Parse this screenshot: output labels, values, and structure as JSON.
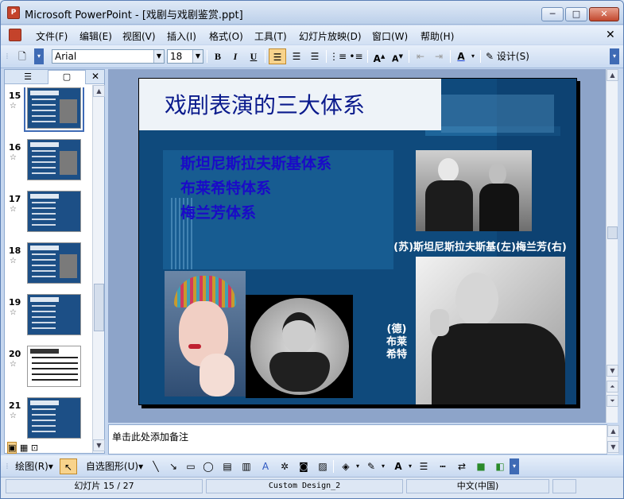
{
  "window": {
    "title": "Microsoft PowerPoint - [戏剧与戏剧鉴赏.ppt]",
    "app_icon": "P"
  },
  "menu": [
    "文件(F)",
    "编辑(E)",
    "视图(V)",
    "插入(I)",
    "格式(O)",
    "工具(T)",
    "幻灯片放映(D)",
    "窗口(W)",
    "帮助(H)"
  ],
  "formatting": {
    "font": "Arial",
    "size": "18",
    "bold": "B",
    "italic": "I",
    "underline": "U",
    "design": "设计(S)"
  },
  "thumbnails": [
    {
      "num": "15",
      "selected": true,
      "title": "戏剧表演的三大体系"
    },
    {
      "num": "16",
      "selected": false,
      "title": ""
    },
    {
      "num": "17",
      "selected": false,
      "title": ""
    },
    {
      "num": "18",
      "selected": false,
      "title": ""
    },
    {
      "num": "19",
      "selected": false,
      "title": ""
    },
    {
      "num": "20",
      "selected": false,
      "title": ""
    },
    {
      "num": "21",
      "selected": false,
      "title": ""
    }
  ],
  "slide": {
    "title": "戏剧表演的三大体系",
    "bullets": [
      "斯坦尼斯拉夫斯基体系",
      "布莱希特体系",
      "梅兰芳体系"
    ],
    "caption_top": "(苏)斯坦尼斯拉夫斯基(左)梅兰芳(右)",
    "caption_bottom": [
      "(德)",
      "布莱",
      "希特"
    ]
  },
  "notes_placeholder": "单击此处添加备注",
  "drawing": {
    "draw_label": "绘图(R)",
    "autoshapes_label": "自选图形(U)"
  },
  "status": {
    "slide": "幻灯片 15 / 27",
    "design": "Custom Design_2",
    "language": "中文(中国)"
  },
  "colors": {
    "slide_bg": "#0f4a7c",
    "title_color": "#0a1a8c",
    "bullet_color": "#1a0ac8"
  }
}
